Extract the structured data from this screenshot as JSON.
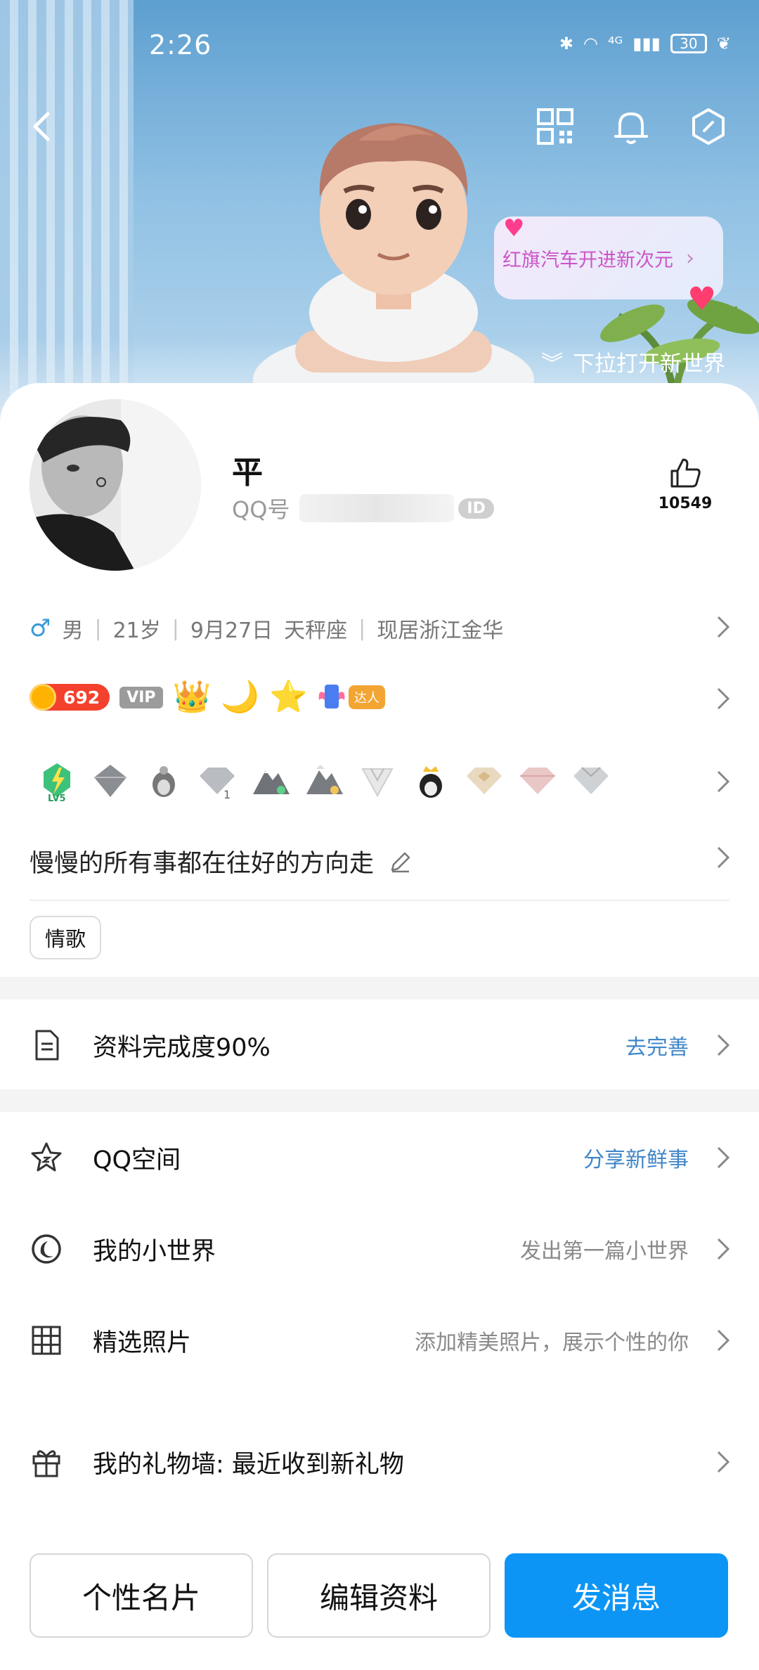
{
  "status_bar": {
    "time": "2:26",
    "signal_text": "⁴ᴳ",
    "battery": "30"
  },
  "hero": {
    "bubble_text": "红旗汽车开进新次元",
    "pull_hint": "下拉打开新世界"
  },
  "profile": {
    "nickname": "平",
    "qq_label": "QQ号",
    "id_badge": "ID",
    "like_count": "10549"
  },
  "info": {
    "gender_symbol": "♂",
    "gender": "男",
    "age": "21岁",
    "birthday": "9月27日",
    "zodiac": "天秤座",
    "location": "现居浙江金华"
  },
  "badges": {
    "coin_value": "692",
    "vip": "VIP",
    "crown": "👑",
    "moon": "🌙",
    "star": "⭐",
    "daren": "达人"
  },
  "gems": {
    "level": "LV5"
  },
  "signature": "慢慢的所有事都在往好的方向走",
  "tags": [
    "情歌"
  ],
  "completion": {
    "label": "资料完成度90%",
    "action": "去完善"
  },
  "menu": [
    {
      "label": "QQ空间",
      "right": "分享新鲜事",
      "icon": "star-outline-icon"
    },
    {
      "label": "我的小世界",
      "right": "发出第一篇小世界",
      "icon": "moon-circle-icon"
    },
    {
      "label": "精选照片",
      "right": "添加精美照片，展示个性的你",
      "icon": "grid-icon"
    },
    {
      "label": "我的礼物墙: 最近收到新礼物",
      "right": "",
      "icon": "gift-icon"
    }
  ],
  "buttons": {
    "card": "个性名片",
    "edit": "编辑资料",
    "message": "发消息"
  },
  "colors": {
    "primary_blue": "#0d95f5",
    "link_blue": "#3f86c8",
    "coin_red": "#f4412d"
  }
}
